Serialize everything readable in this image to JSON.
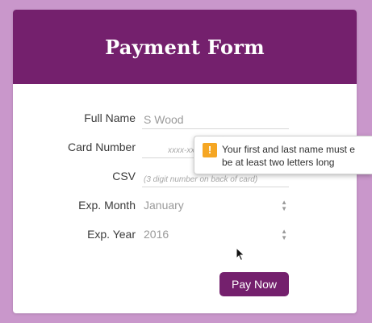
{
  "form": {
    "title": "Payment Form",
    "fields": [
      {
        "label": "Full Name",
        "value": "S Wood",
        "placeholder": ""
      },
      {
        "label": "Card Number",
        "value": "",
        "placeholder": "xxxx-xxxx-xxxx-xxxx"
      },
      {
        "label": "CSV",
        "value": "",
        "placeholder": "(3 digit number on back of card)"
      },
      {
        "label": "Exp. Month",
        "value": "January"
      },
      {
        "label": "Exp. Year",
        "value": "2016"
      }
    ],
    "submit_label": "Pay Now"
  },
  "tooltip": {
    "line1": "Your first and last name must e",
    "line2": "be at least two letters long",
    "icon_glyph": "!",
    "icon": "warning-icon"
  },
  "colors": {
    "background": "#c997cb",
    "header": "#74206d",
    "button": "#74206d",
    "warning": "#f5a623"
  }
}
